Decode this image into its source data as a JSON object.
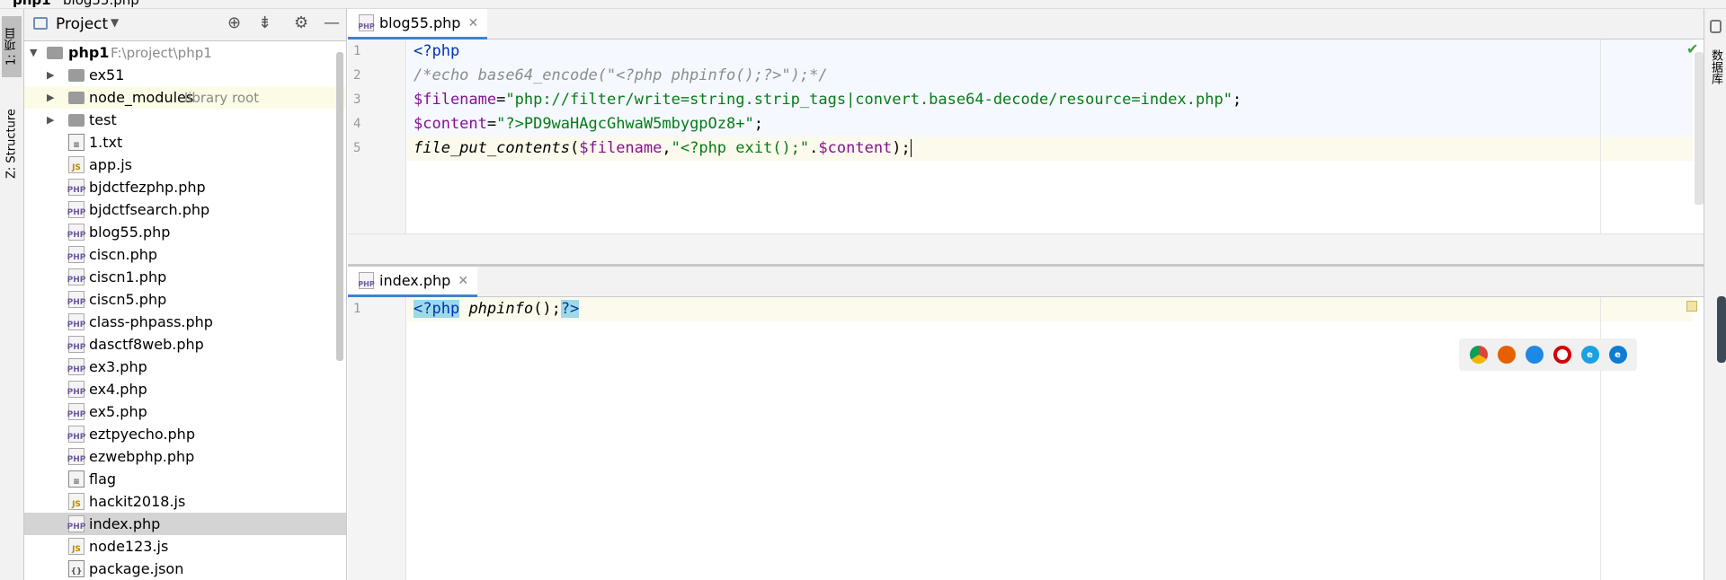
{
  "topbar": {
    "project": "php1",
    "file": "blog55.php"
  },
  "left_strip": {
    "project_tab": "1: 项目",
    "structure_tab": "Z: Structure"
  },
  "project_panel": {
    "title": "Project",
    "root": {
      "name": "php1",
      "path": "F:\\project\\php1"
    },
    "folders": [
      {
        "name": "ex51",
        "note": ""
      },
      {
        "name": "node_modules",
        "note": "library root"
      },
      {
        "name": "test",
        "note": ""
      }
    ],
    "files": [
      {
        "name": "1.txt",
        "type": "txt"
      },
      {
        "name": "app.js",
        "type": "js"
      },
      {
        "name": "bjdctfezphp.php",
        "type": "php"
      },
      {
        "name": "bjdctfsearch.php",
        "type": "php"
      },
      {
        "name": "blog55.php",
        "type": "php"
      },
      {
        "name": "ciscn.php",
        "type": "php"
      },
      {
        "name": "ciscn1.php",
        "type": "php"
      },
      {
        "name": "ciscn5.php",
        "type": "php"
      },
      {
        "name": "class-phpass.php",
        "type": "php"
      },
      {
        "name": "dasctf8web.php",
        "type": "php"
      },
      {
        "name": "ex3.php",
        "type": "php"
      },
      {
        "name": "ex4.php",
        "type": "php"
      },
      {
        "name": "ex5.php",
        "type": "php"
      },
      {
        "name": "eztpyecho.php",
        "type": "php"
      },
      {
        "name": "ezwebphp.php",
        "type": "php"
      },
      {
        "name": "flag",
        "type": "txt"
      },
      {
        "name": "hackit2018.js",
        "type": "js"
      },
      {
        "name": "index.php",
        "type": "php",
        "selected": true
      },
      {
        "name": "node123.js",
        "type": "js"
      },
      {
        "name": "package.json",
        "type": "json"
      }
    ]
  },
  "editor_top": {
    "tab": "blog55.php",
    "line_numbers": [
      "1",
      "2",
      "3",
      "4",
      "5"
    ],
    "lines": [
      {
        "a": "<?php"
      },
      {
        "a": "/*echo base64_encode(\"<?php phpinfo();?>\");*/"
      },
      {
        "a": "$filename",
        "b": "=",
        "c": "\"php://filter/write=string.strip_tags|convert.base64-decode/resource=index.php\"",
        "d": ";"
      },
      {
        "a": "$content",
        "b": "=",
        "c": "\"?>PD9waHAgcGhwaW5mbygpOz8+\"",
        "d": ";"
      },
      {
        "a": "file_put_contents",
        "b": "(",
        "c": "$filename",
        "d": ",",
        "e": "\"<?php exit();\"",
        "f": ".",
        "g": "$content",
        "h": ");"
      }
    ]
  },
  "editor_bottom": {
    "tab": "index.php",
    "line_numbers": [
      "1"
    ],
    "line": {
      "open": "<?php",
      "fn": "phpinfo",
      "mid": "();",
      "close": "?>"
    }
  },
  "right_strip": {
    "database_tab": "数据库"
  },
  "browsers": [
    "chrome-icon",
    "firefox-icon",
    "safari-icon",
    "opera-icon",
    "ie-icon",
    "edge-icon"
  ],
  "colors": {
    "accent": "#4083c9",
    "selection": "#d4d4d4",
    "tag_highlight": "#9ed9e7"
  }
}
